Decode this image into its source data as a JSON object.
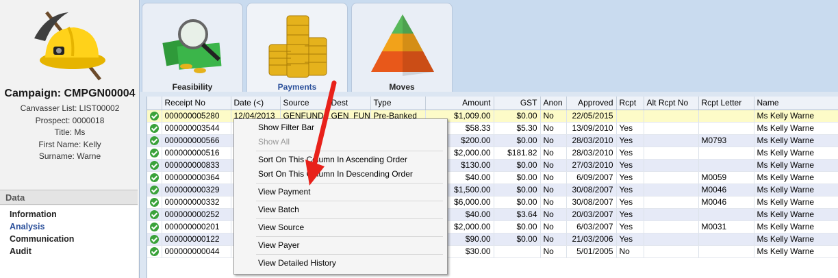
{
  "left": {
    "campaign": "Campaign: CMPGN00004",
    "info": [
      "Canvasser List: LIST00002",
      "Prospect: 0000018",
      "Title: Ms",
      "First Name: Kelly",
      "Surname: Warne"
    ],
    "data_header": "Data",
    "data_items": [
      "Information",
      "Analysis",
      "Communication",
      "Audit"
    ]
  },
  "tabs": [
    {
      "label": "Feasibility",
      "icon": "money-magnifier-icon"
    },
    {
      "label": "Payments",
      "icon": "coin-stacks-icon"
    },
    {
      "label": "Moves",
      "icon": "pyramid-icon"
    }
  ],
  "grid": {
    "columns": [
      "",
      "Receipt No",
      "Date (<)",
      "Source",
      "Dest",
      "Type",
      "Amount",
      "GST",
      "Anon",
      "Approved",
      "Rcpt",
      "Alt Rcpt No",
      "Rcpt Letter",
      "Name"
    ],
    "rows": [
      [
        "000000005280",
        "12/04/2013",
        "GENFUND",
        "GEN_FUN",
        "Pre-Banked",
        "$1,009.00",
        "$0.00",
        "No",
        "22/05/2015",
        "",
        "",
        "",
        "Ms Kelly Warne"
      ],
      [
        "000000003544",
        "",
        "",
        "",
        "",
        "$58.33",
        "$5.30",
        "No",
        "13/09/2010",
        "Yes",
        "",
        "",
        "Ms Kelly Warne"
      ],
      [
        "000000000566",
        "",
        "",
        "",
        "",
        "$200.00",
        "$0.00",
        "No",
        "28/03/2010",
        "Yes",
        "",
        "M0793",
        "Ms Kelly Warne"
      ],
      [
        "000000000516",
        "",
        "",
        "",
        "",
        "$2,000.00",
        "$181.82",
        "No",
        "28/03/2010",
        "Yes",
        "",
        "",
        "Ms Kelly Warne"
      ],
      [
        "000000000833",
        "",
        "",
        "",
        "",
        "$130.00",
        "$0.00",
        "No",
        "27/03/2010",
        "Yes",
        "",
        "",
        "Ms Kelly Warne"
      ],
      [
        "000000000364",
        "",
        "",
        "",
        "",
        "$40.00",
        "$0.00",
        "No",
        "6/09/2007",
        "Yes",
        "",
        "M0059",
        "Ms Kelly Warne"
      ],
      [
        "000000000329",
        "",
        "",
        "",
        "",
        "$1,500.00",
        "$0.00",
        "No",
        "30/08/2007",
        "Yes",
        "",
        "M0046",
        "Ms Kelly Warne"
      ],
      [
        "000000000332",
        "",
        "",
        "",
        "",
        "$6,000.00",
        "$0.00",
        "No",
        "30/08/2007",
        "Yes",
        "",
        "M0046",
        "Ms Kelly Warne"
      ],
      [
        "000000000252",
        "",
        "",
        "",
        "",
        "$40.00",
        "$3.64",
        "No",
        "20/03/2007",
        "Yes",
        "",
        "",
        "Ms Kelly Warne"
      ],
      [
        "000000000201",
        "",
        "",
        "",
        "",
        "$2,000.00",
        "$0.00",
        "No",
        "6/03/2007",
        "Yes",
        "",
        "M0031",
        "Ms Kelly Warne"
      ],
      [
        "000000000122",
        "",
        "",
        "",
        "",
        "$90.00",
        "$0.00",
        "No",
        "21/03/2006",
        "Yes",
        "",
        "",
        "Ms Kelly Warne"
      ],
      [
        "000000000044",
        "",
        "",
        "",
        "",
        "$30.00",
        "",
        "No",
        "5/01/2005",
        "No",
        "",
        "",
        "Ms Kelly Warne"
      ]
    ]
  },
  "context_menu": [
    {
      "label": "Show Filter Bar",
      "enabled": true
    },
    {
      "label": "Show All",
      "enabled": false
    },
    {
      "sep": true
    },
    {
      "label": "Sort On This Column In Ascending Order",
      "enabled": true
    },
    {
      "label": "Sort On This Column In Descending Order",
      "enabled": true
    },
    {
      "sep": true
    },
    {
      "label": "View Payment",
      "enabled": true
    },
    {
      "sep": true
    },
    {
      "label": "View Batch",
      "enabled": true
    },
    {
      "sep": true
    },
    {
      "label": "View Source",
      "enabled": true
    },
    {
      "sep": true
    },
    {
      "label": "View Payer",
      "enabled": true
    },
    {
      "sep": true
    },
    {
      "label": "View Detailed History",
      "enabled": true
    }
  ],
  "colors": {
    "accent": "#2a4f9a",
    "selected_row": "#fdfbc8",
    "alt_row": "#e6eaf7",
    "arrow": "#e8211a"
  }
}
